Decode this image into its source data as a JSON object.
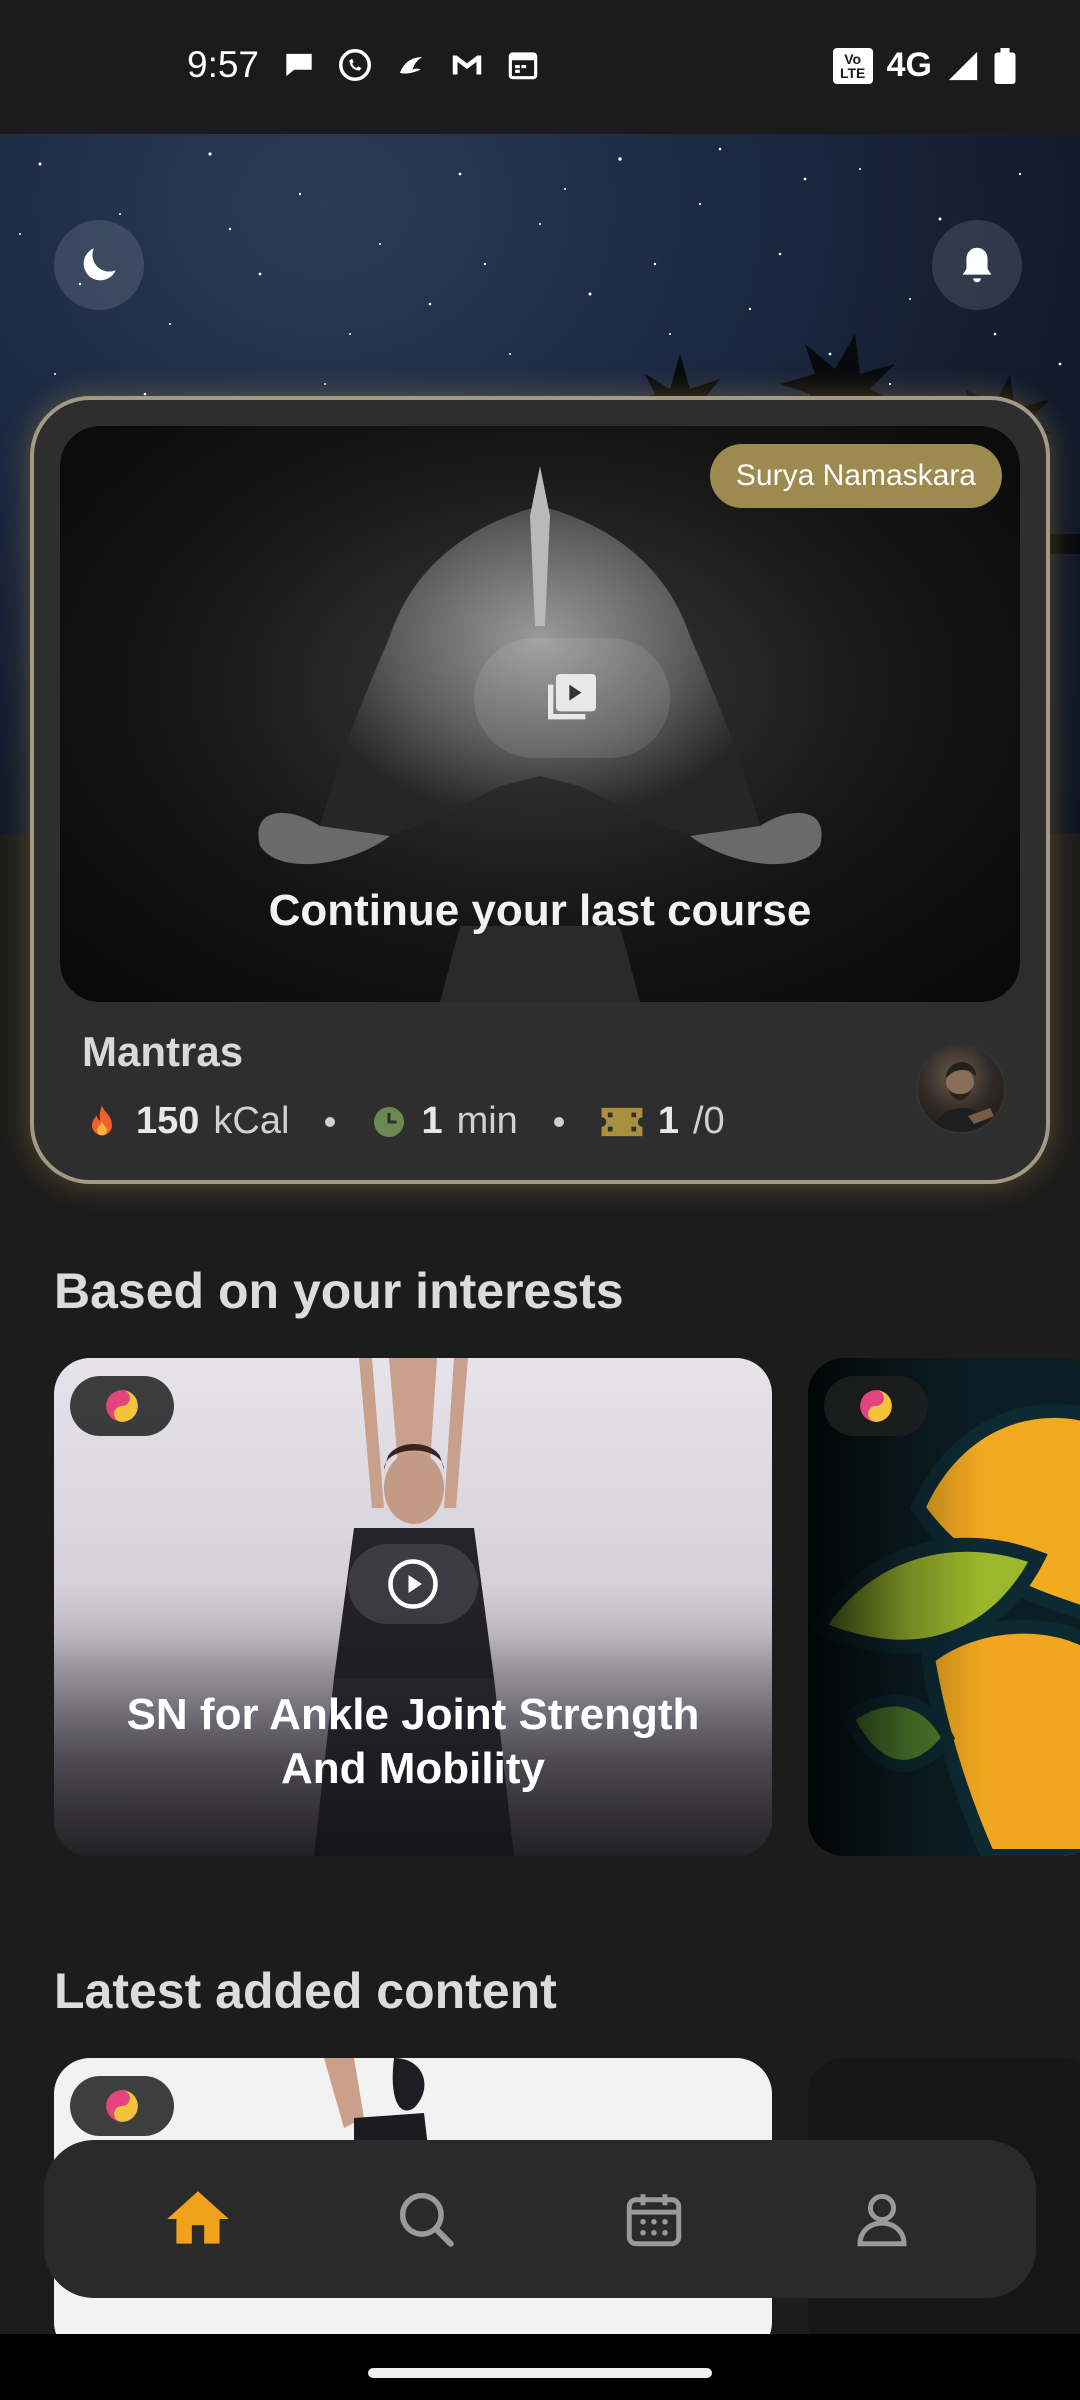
{
  "status_bar": {
    "time": "9:57",
    "network": "4G",
    "volte": "Vo LTE",
    "left_icons": [
      "chat-bubble-icon",
      "whatsapp-icon",
      "swirl-app-icon",
      "gmail-icon",
      "calendar-icon"
    ],
    "right_icons": [
      "signal-icon",
      "battery-icon"
    ]
  },
  "header": {
    "left_button_icon": "moon-icon",
    "right_button_icon": "bell-icon"
  },
  "continue_card": {
    "tag": "Surya Namaskara",
    "caption": "Continue your last course",
    "title": "Mantras",
    "calories_value": "150",
    "calories_unit": "kCal",
    "duration_value": "1",
    "duration_unit": "min",
    "videos_value": "1",
    "videos_total": "/0",
    "accent_color": "#a29a84"
  },
  "interests": {
    "title": "Based on your interests",
    "cards": [
      {
        "title": "SN for Ankle Joint Strength And Mobility",
        "icon": "yin-yang-icon"
      },
      {
        "title": "",
        "icon": "yin-yang-icon"
      }
    ]
  },
  "latest": {
    "title": "Latest added content"
  },
  "bottom_nav": {
    "items": [
      {
        "name": "home",
        "icon": "home-icon",
        "active": true
      },
      {
        "name": "search",
        "icon": "search-icon",
        "active": false
      },
      {
        "name": "calendar",
        "icon": "calendar-icon",
        "active": false
      },
      {
        "name": "profile",
        "icon": "profile-icon",
        "active": false
      }
    ],
    "active_color": "#f2a11b",
    "inactive_color": "#9a9a9a"
  }
}
